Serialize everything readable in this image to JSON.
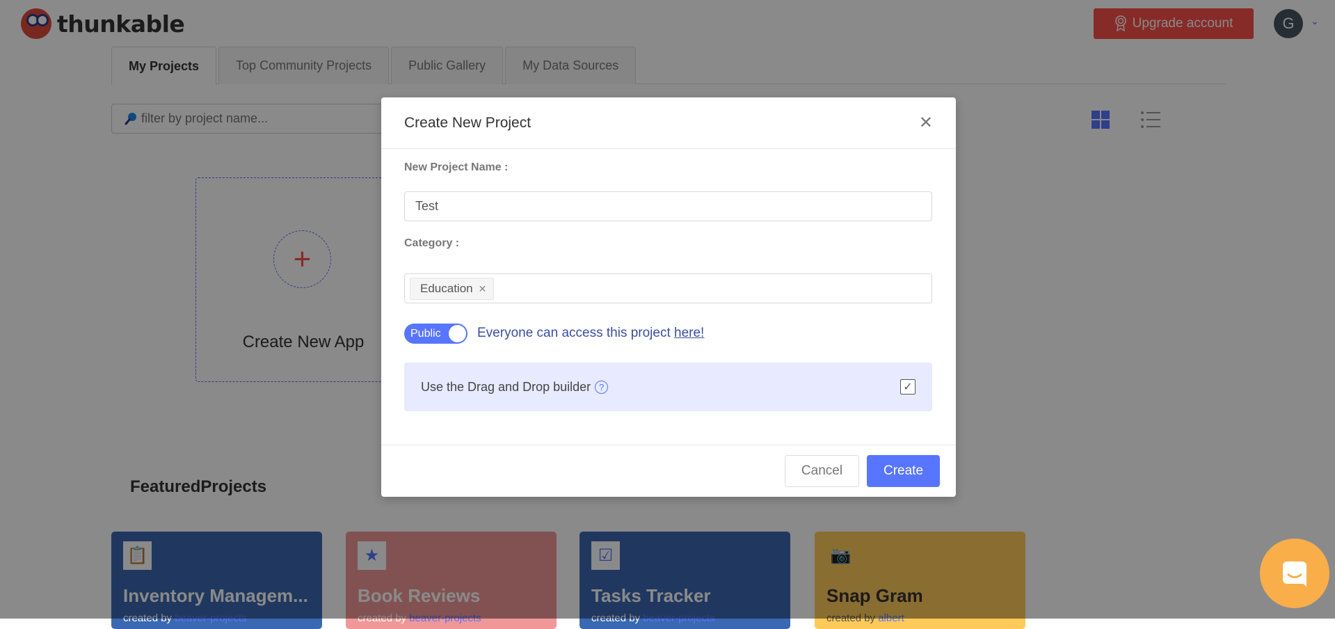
{
  "app": {
    "logo_text": "thunkable"
  },
  "header": {
    "upgrade_label": "Upgrade account",
    "avatar_initial": "G"
  },
  "tabs": [
    {
      "label": "My Projects",
      "active": true
    },
    {
      "label": "Top Community Projects"
    },
    {
      "label": "Public Gallery"
    },
    {
      "label": "My Data Sources"
    }
  ],
  "search": {
    "placeholder": "filter by project name...",
    "value": ""
  },
  "view": {
    "selected": "grid"
  },
  "create_card": {
    "label": "Create New App"
  },
  "featured": {
    "title": "FeaturedProjects",
    "created_by_prefix": "created by",
    "cards": [
      {
        "title": "Inventory Managem...",
        "author": "beaver-projects",
        "color": "#3b68b2",
        "icon": "clipboard-icon"
      },
      {
        "title": "Book Reviews",
        "author": "beaver-projects",
        "color": "#f09898",
        "icon": "bookmark-star-icon"
      },
      {
        "title": "Tasks Tracker",
        "author": "beaver-projects",
        "color": "#3b68b2",
        "icon": "checklist-icon"
      },
      {
        "title": "Snap Gram",
        "author": "albert",
        "color": "#ffca59",
        "icon": "camera-icon"
      }
    ]
  },
  "modal": {
    "title": "Create New Project",
    "name_label": "New Project Name :",
    "name_value": "Test",
    "category_label": "Category :",
    "category_tag": "Education",
    "toggle_label": "Public",
    "toggle_on": true,
    "public_text": "Everyone can access this project ",
    "public_link": "here!",
    "dnd_label": "Use the Drag and Drop builder",
    "dnd_checked": true,
    "cancel_label": "Cancel",
    "create_label": "Create"
  },
  "colors": {
    "accent": "#5775ff",
    "upgrade": "#f7504a",
    "intercom": "#f9ae4a"
  }
}
